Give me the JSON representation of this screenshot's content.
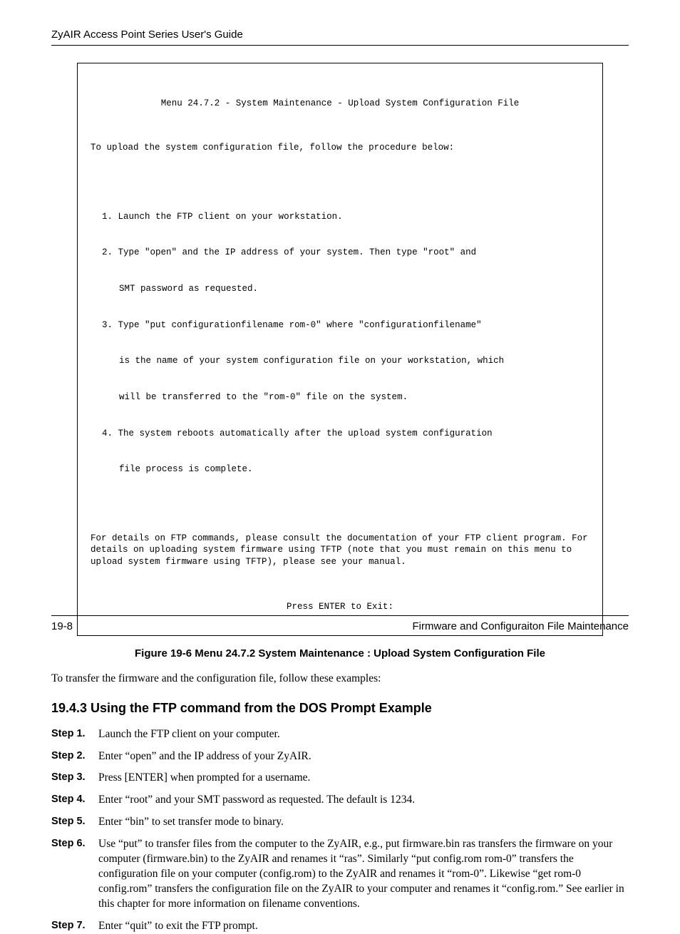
{
  "header": {
    "title": "ZyAIR Access Point Series User's Guide"
  },
  "terminal": {
    "title": "Menu 24.7.2 - System Maintenance - Upload System Configuration File",
    "intro": "To upload the system configuration file, follow the procedure below:",
    "items": [
      {
        "num": "1.",
        "lines": [
          "Launch the FTP client on your workstation."
        ]
      },
      {
        "num": "2.",
        "lines": [
          "Type \"open\" and the IP address of your system. Then type \"root\" and",
          "SMT password as requested."
        ]
      },
      {
        "num": "3.",
        "lines": [
          "Type \"put configurationfilename rom-0\" where \"configurationfilename\"",
          "is the name of your system configuration file on your workstation, which",
          "will be transferred to the \"rom-0\" file on the system."
        ]
      },
      {
        "num": "4.",
        "lines": [
          "The system reboots automatically after the upload system configuration",
          "file process is complete."
        ]
      }
    ],
    "para": "For details on FTP commands, please consult the documentation of your FTP client program. For details on uploading system firmware using TFTP (note that you must remain on this menu to upload system firmware using TFTP), please see your manual.",
    "exit": "Press ENTER to Exit:"
  },
  "figure_caption": "Figure 19-6 Menu 24.7.2 System Maintenance : Upload System Configuration File",
  "intro_text": "To transfer the firmware and the configuration file, follow these examples:",
  "section_heading": "19.4.3 Using the FTP command from the DOS Prompt Example",
  "steps": [
    {
      "label": "Step 1.",
      "text": "Launch the FTP client on your computer."
    },
    {
      "label": "Step 2.",
      "text": "Enter “open” and the IP address of your ZyAIR."
    },
    {
      "label": "Step 3.",
      "text": "Press [ENTER] when prompted for a username."
    },
    {
      "label": "Step 4.",
      "text": "Enter “root” and your SMT password as requested. The default is 1234."
    },
    {
      "label": "Step 5.",
      "text": "Enter “bin” to set transfer mode to binary."
    },
    {
      "label": "Step 6.",
      "text": "Use “put” to transfer files from the computer to the ZyAIR, e.g., put firmware.bin ras transfers the firmware on your computer (firmware.bin) to the ZyAIR and renames it “ras”. Similarly “put config.rom rom-0” transfers the configuration file on your computer (config.rom) to the ZyAIR and renames it “rom-0”. Likewise “get rom-0 config.rom” transfers the configuration file on the ZyAIR to your computer and renames it “config.rom.” See earlier in this chapter for more information on filename conventions."
    },
    {
      "label": "Step 7.",
      "text": "Enter “quit” to exit the FTP prompt."
    }
  ],
  "footer": {
    "left": "19-8",
    "right": "Firmware and Configuraiton File Maintenance"
  }
}
